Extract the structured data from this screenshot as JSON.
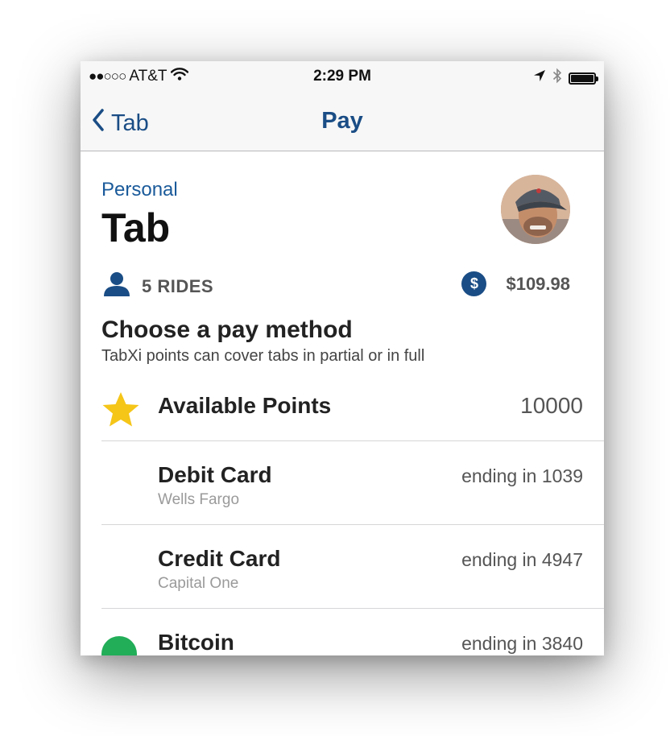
{
  "status_bar": {
    "signal": "●●○○○",
    "carrier": "AT&T",
    "time": "2:29 PM",
    "icons": [
      "wifi-icon",
      "location-arrow-icon",
      "bluetooth-icon",
      "battery-icon"
    ]
  },
  "nav": {
    "back_label": "Tab",
    "title": "Pay"
  },
  "header": {
    "subtitle": "Personal",
    "title": "Tab"
  },
  "stats": {
    "rides": "5 RIDES",
    "amount": "$109.98"
  },
  "pay_section": {
    "heading": "Choose a pay method",
    "description": "TabXi points can cover tabs in partial or in full"
  },
  "methods": [
    {
      "name": "Available Points",
      "sub": "",
      "right": "10000",
      "icon": "star-icon"
    },
    {
      "name": "Debit Card",
      "sub": "Wells Fargo",
      "right": "ending in 1039",
      "icon": "card-icon"
    },
    {
      "name": "Credit Card",
      "sub": "Capital One",
      "right": "ending in 4947",
      "icon": "card-icon"
    },
    {
      "name": "Bitcoin",
      "sub": "",
      "right": "ending in 3840",
      "icon": "bitcoin-icon"
    }
  ],
  "colors": {
    "nav_blue": "#1a4d85",
    "label_blue": "#1a5a9a",
    "card_green": "#22ad58",
    "star_yellow": "#f5c518"
  }
}
